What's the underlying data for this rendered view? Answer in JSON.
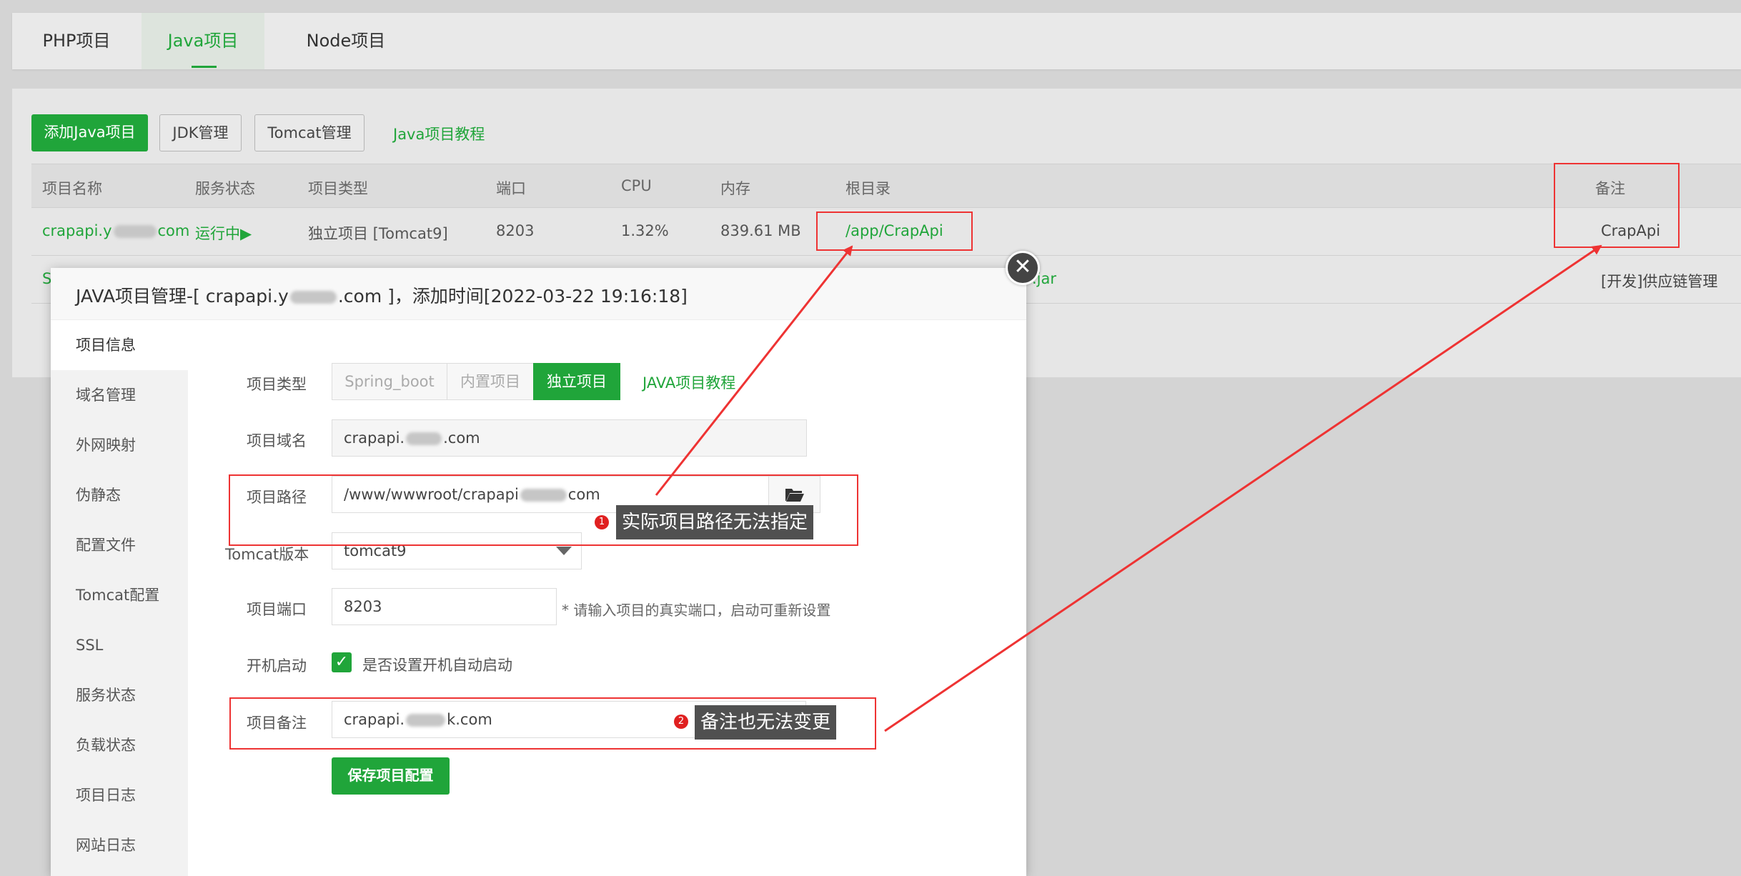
{
  "tabs": [
    {
      "label": "PHP项目"
    },
    {
      "label": "Java项目"
    },
    {
      "label": "Node项目"
    }
  ],
  "toolbar": {
    "add_label": "添加Java项目",
    "jdk_label": "JDK管理",
    "tomcat_label": "Tomcat管理",
    "tutorial_link": "Java项目教程"
  },
  "table": {
    "headers": [
      "项目名称",
      "服务状态",
      "项目类型",
      "端口",
      "CPU",
      "内存",
      "根目录",
      "备注"
    ],
    "row1": {
      "name_prefix": "crapapi.y",
      "name_suffix": "com",
      "status": "运行中▶",
      "type": "独立项目 [Tomcat9]",
      "port": "8203",
      "cpu": "1.32%",
      "memory": "839.61 MB",
      "root": "/app/CrapApi",
      "remark": "CrapApi"
    },
    "row2": {
      "name_fragment": "S",
      "root_fragment": ".jar",
      "remark": "[开发]供应链管理"
    }
  },
  "modal": {
    "title_prefix": "JAVA项目管理-[ crapapi.y",
    "title_suffix": ".com ]，添加时间[2022-03-22 19:16:18]",
    "close_symbol": "✕",
    "sidebar": [
      {
        "label": "项目信息"
      },
      {
        "label": "域名管理"
      },
      {
        "label": "外网映射"
      },
      {
        "label": "伪静态"
      },
      {
        "label": "配置文件"
      },
      {
        "label": "Tomcat配置"
      },
      {
        "label": "SSL"
      },
      {
        "label": "服务状态"
      },
      {
        "label": "负载状态"
      },
      {
        "label": "项目日志"
      },
      {
        "label": "网站日志"
      }
    ],
    "form": {
      "type_label": "项目类型",
      "type_options": [
        "Spring_boot",
        "内置项目",
        "独立项目"
      ],
      "tutorial_link": "JAVA项目教程",
      "domain_label": "项目域名",
      "domain_prefix": "crapapi.",
      "domain_suffix": ".com",
      "path_label": "项目路径",
      "path_prefix": "/www/wwwroot/crapapi",
      "path_suffix": "com",
      "tomcat_label": "Tomcat版本",
      "tomcat_value": "tomcat9",
      "port_label": "项目端口",
      "port_value": "8203",
      "port_hint": "* 请输入项目的真实端口，启动可重新设置",
      "boot_label": "开机启动",
      "boot_check": "✓",
      "boot_text": "是否设置开机自动启动",
      "remark_label": "项目备注",
      "remark_prefix": "crapapi.",
      "remark_suffix": "k.com",
      "save_label": "保存项目配置"
    }
  },
  "annotations": {
    "note1_badge": "1",
    "note1_text": "实际项目路径无法指定",
    "note2_badge": "2",
    "note2_text": "备注也无法变更"
  },
  "colors": {
    "accent": "#20a53a",
    "annotation_red": "#ee3333"
  }
}
